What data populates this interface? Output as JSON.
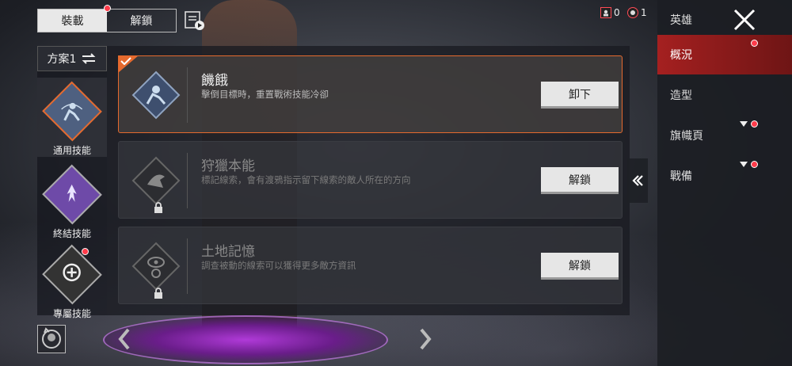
{
  "top_tabs": [
    {
      "label": "裝載"
    },
    {
      "label": "解鎖"
    }
  ],
  "counters": {
    "a": "0",
    "b": "1"
  },
  "preset": {
    "label": "方案1"
  },
  "categories": [
    {
      "label": "通用技能"
    },
    {
      "label": "終結技能"
    },
    {
      "label": "專屬技能"
    }
  ],
  "perks": [
    {
      "name": "饑餓",
      "desc": "擊倒目標時，重置戰術技能冷卻",
      "button": "卸下"
    },
    {
      "name": "狩獵本能",
      "desc": "標記線索，會有渡鴉指示留下線索的敵人所在的方向",
      "button": "解鎖"
    },
    {
      "name": "土地記憶",
      "desc": "調查被動的線索可以獲得更多敵方資訊",
      "button": "解鎖"
    }
  ],
  "right_menu": {
    "title": "英雄",
    "items": [
      {
        "label": "概況"
      },
      {
        "label": "造型"
      },
      {
        "label": "旗幟頁"
      },
      {
        "label": "戰備"
      }
    ]
  },
  "colors": {
    "accent": "#e56a2e",
    "active_red": "#a52020",
    "badge": "#ff3b4a",
    "ability_blue": "#5a6e8c",
    "ability_purple": "#6e4aa8"
  }
}
